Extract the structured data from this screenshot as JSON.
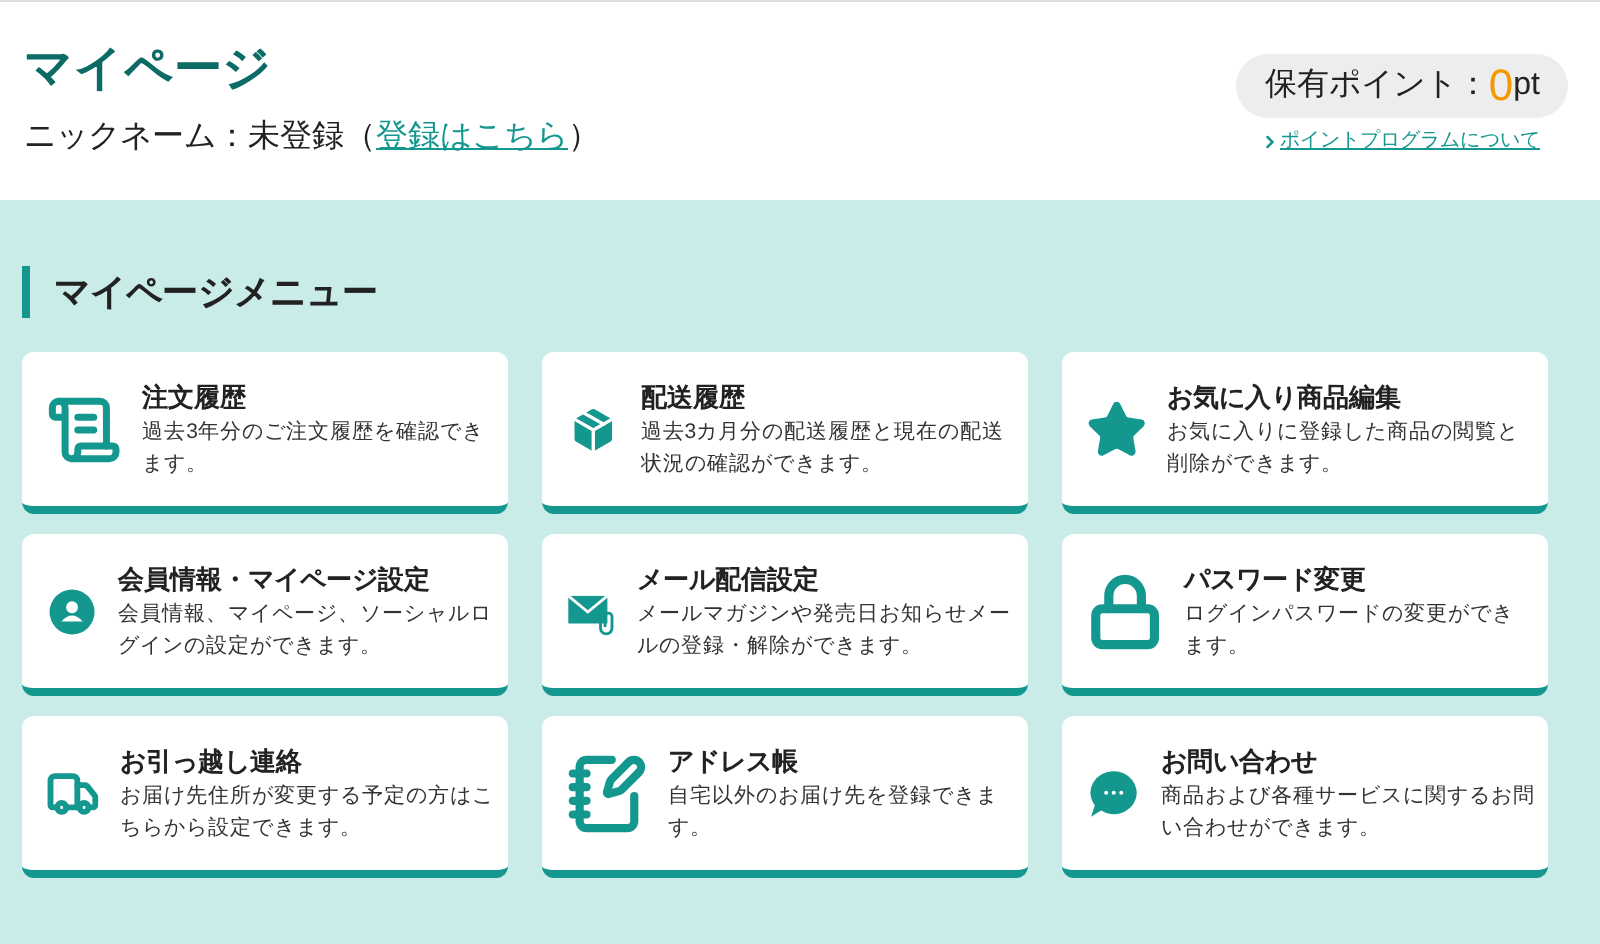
{
  "header": {
    "title": "マイページ",
    "nickname": {
      "prefix": "ニックネーム：未登録（",
      "link": "登録はこちら",
      "suffix": "）"
    },
    "points": {
      "label": "保有ポイント：",
      "value": "0",
      "unit": "pt"
    },
    "points_link": "ポイントプログラムについて"
  },
  "menu": {
    "heading": "マイページメニュー",
    "items": [
      {
        "title": "注文履歴",
        "description": "過去3年分のご注文履歴を確認できます。"
      },
      {
        "title": "配送履歴",
        "description": "過去3カ月分の配送履歴と現在の配送状況の確認ができます。"
      },
      {
        "title": "お気に入り商品編集",
        "description": "お気に入りに登録した商品の閲覧と削除ができます。"
      },
      {
        "title": "会員情報・マイページ設定",
        "description": "会員情報、マイページ、ソーシャルログインの設定ができます。"
      },
      {
        "title": "メール配信設定",
        "description": "メールマガジンや発売日お知らせメールの登録・解除ができます。"
      },
      {
        "title": "パスワード変更",
        "description": "ログインパスワードの変更ができます。"
      },
      {
        "title": "お引っ越し連絡",
        "description": "お届け先住所が変更する予定の方はこちらから設定できます。"
      },
      {
        "title": "アドレス帳",
        "description": "自宅以外のお届け先を登録できます。"
      },
      {
        "title": "お問い合わせ",
        "description": "商品および各種サービスに関するお問い合わせができます。"
      }
    ]
  }
}
